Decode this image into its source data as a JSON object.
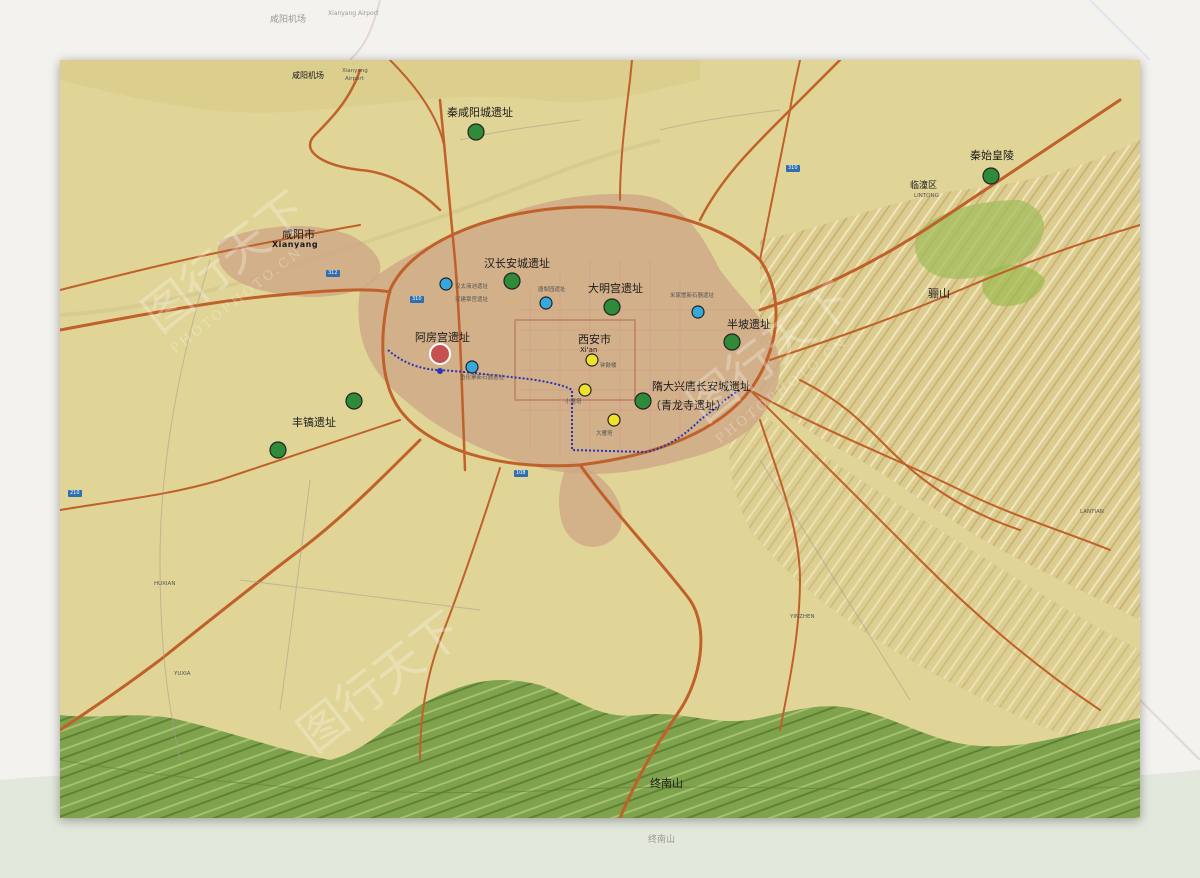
{
  "background_labels": {
    "xianyang_airport_cn": "咸阳机场",
    "xianyang_airport_en": "Xianyang Airport",
    "bottom_zhongnan": "终南山"
  },
  "map": {
    "colors": {
      "plain": "#e0d596",
      "urban": "#cfa987",
      "highway": "#c0602a",
      "forest": "#7fa24c",
      "dot_green": "#2f8a3a",
      "dot_blue": "#36a8dc",
      "dot_yellow": "#f0e22a",
      "dot_red": "#c65151",
      "route": "#2635b8"
    },
    "labels": {
      "xianyang_airport_cn": "咸阳机场",
      "xianyang_airport_en_1": "Xianyang",
      "xianyang_airport_en_2": "Airport",
      "qin_xianyang": "秦咸阳城遗址",
      "xianyang_city": "咸阳市",
      "xianyang_en": "Xianyang",
      "han_changan": "汉长安城遗址",
      "daming_palace": "大明宫遗址",
      "weiyang_1": "汉太液池遗址",
      "weiyang_2": "汉建章宫遗址",
      "tang_xiaoyuan": "唐梨园遗址",
      "mijia_ya": "米家崖新石器遗址",
      "banpo": "半坡遗址",
      "epang_palace": "阿房宫遗址",
      "xian_city": "西安市",
      "xian_en": "Xi'an",
      "bell_tower": "钟鼓楼",
      "xiyu_neolithic": "鱼化寨新石器遗址",
      "small_goose": "小雁塔",
      "big_goose": "大雁塔",
      "sui_daxing": "隋大兴唐长安城遗址",
      "qinglong_temple": "（青龙寺遗址）",
      "fenghao": "丰镐遗址",
      "qinshihuang": "秦始皇陵",
      "lintong": "临潼区",
      "lintong_en": "LINTONG",
      "lishan": "骊山",
      "zhongnan": "终南山",
      "lantian_en": "LANTIAN",
      "huxian_en": "HUXIAN",
      "yuxia_en": "YUXIA",
      "yinzhen_en": "YINZHEN"
    },
    "road_shields": [
      "310",
      "312",
      "210",
      "310",
      "108"
    ],
    "markers": [
      {
        "name": "秦咸阳城遗址",
        "kind": "green"
      },
      {
        "name": "秦始皇陵",
        "kind": "green"
      },
      {
        "name": "汉长安城遗址",
        "kind": "green"
      },
      {
        "name": "大明宫遗址",
        "kind": "green"
      },
      {
        "name": "半坡遗址",
        "kind": "green"
      },
      {
        "name": "隋大兴唐长安城遗址",
        "kind": "green"
      },
      {
        "name": "丰镐遗址",
        "kind": "green"
      },
      {
        "name": "汉太液池遗址",
        "kind": "blue"
      },
      {
        "name": "唐梨园遗址",
        "kind": "blue"
      },
      {
        "name": "米家崖新石器遗址",
        "kind": "blue"
      },
      {
        "name": "鱼化寨新石器遗址",
        "kind": "blue"
      },
      {
        "name": "钟鼓楼",
        "kind": "yellow"
      },
      {
        "name": "小雁塔",
        "kind": "yellow"
      },
      {
        "name": "大雁塔",
        "kind": "yellow"
      },
      {
        "name": "阿房宫遗址",
        "kind": "red"
      }
    ]
  },
  "watermark": {
    "brand_cn": "图行天下",
    "domain": "PHOTOPHOTO.CN"
  }
}
